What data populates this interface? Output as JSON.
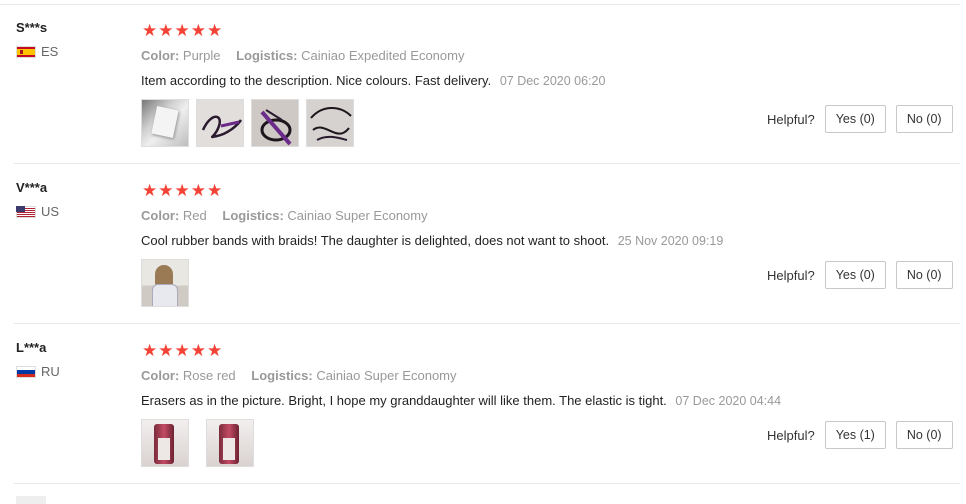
{
  "reviews": [
    {
      "user": "S***s",
      "country": "ES",
      "stars": "★★★★★",
      "color_label": "Color:",
      "color_value": "Purple",
      "logistics_label": "Logistics:",
      "logistics_value": "Cainiao Expedited Economy",
      "comment": "Item according to the description. Nice colours. Fast delivery.",
      "date": "07 Dec 2020 06:20",
      "photos": [
        "product-photo-white",
        "product-photo-cord",
        "product-photo-cord-knot",
        "product-photo-cord-loops"
      ],
      "helpful_label": "Helpful?",
      "yes": "Yes (0)",
      "no": "No (0)"
    },
    {
      "user": "V***a",
      "country": "US",
      "stars": "★★★★★",
      "color_label": "Color:",
      "color_value": "Red",
      "logistics_label": "Logistics:",
      "logistics_value": "Cainiao Super Economy",
      "comment": "Cool rubber bands with braids! The daughter is delighted, does not want to shoot.",
      "date": "25 Nov 2020 09:19",
      "photos": [
        "customer-photo-girl-braid"
      ],
      "helpful_label": "Helpful?",
      "yes": "Yes (0)",
      "no": "No (0)"
    },
    {
      "user": "L***a",
      "country": "RU",
      "stars": "★★★★★",
      "color_label": "Color:",
      "color_value": "Rose red",
      "logistics_label": "Logistics:",
      "logistics_value": "Cainiao Super Economy",
      "comment": "Erasers as in the picture. Bright, I hope my granddaughter will like them. The elastic is tight.",
      "date": "07 Dec 2020 04:44",
      "photos": [
        "product-photo-pink-braid",
        "product-photo-pink-braid-2"
      ],
      "helpful_label": "Helpful?",
      "yes": "Yes (1)",
      "no": "No (0)"
    }
  ],
  "colors": {
    "star": "#f44336",
    "muted_text": "#999999",
    "border": "#c8c8c8"
  }
}
